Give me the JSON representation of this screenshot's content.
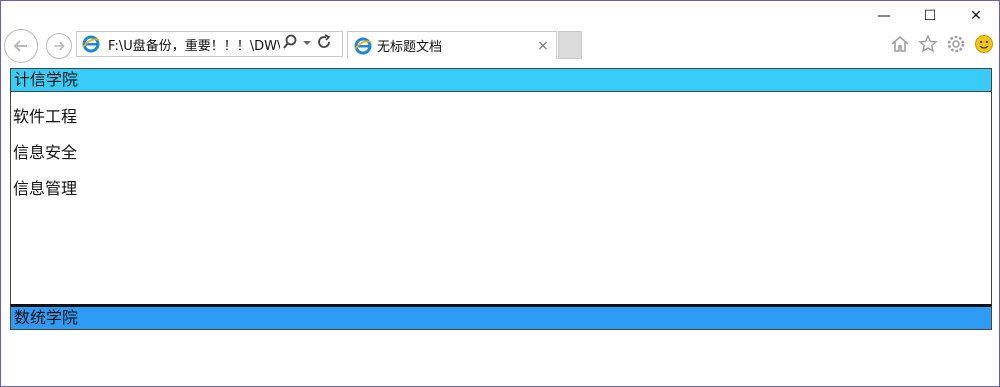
{
  "browser": {
    "address": "F:\\U盘备份，重要！！！\\DW\\",
    "tab_title": "无标题文档",
    "tab_close": "×",
    "window_controls": {
      "minimize": "—",
      "maximize": "☐",
      "close": "✕"
    },
    "icons": [
      "back-arrow-icon",
      "forward-arrow-icon",
      "ie-logo-icon",
      "search-icon",
      "dropdown-icon",
      "refresh-icon",
      "home-icon",
      "favorites-star-icon",
      "settings-gear-icon",
      "smiley-feedback-icon"
    ]
  },
  "page": {
    "section1": {
      "title": "计信学院",
      "items": [
        "软件工程",
        "信息安全",
        "信息管理"
      ],
      "color": "#37cdf8"
    },
    "section2": {
      "title": "数统学院",
      "color": "#2e9bf5"
    }
  }
}
